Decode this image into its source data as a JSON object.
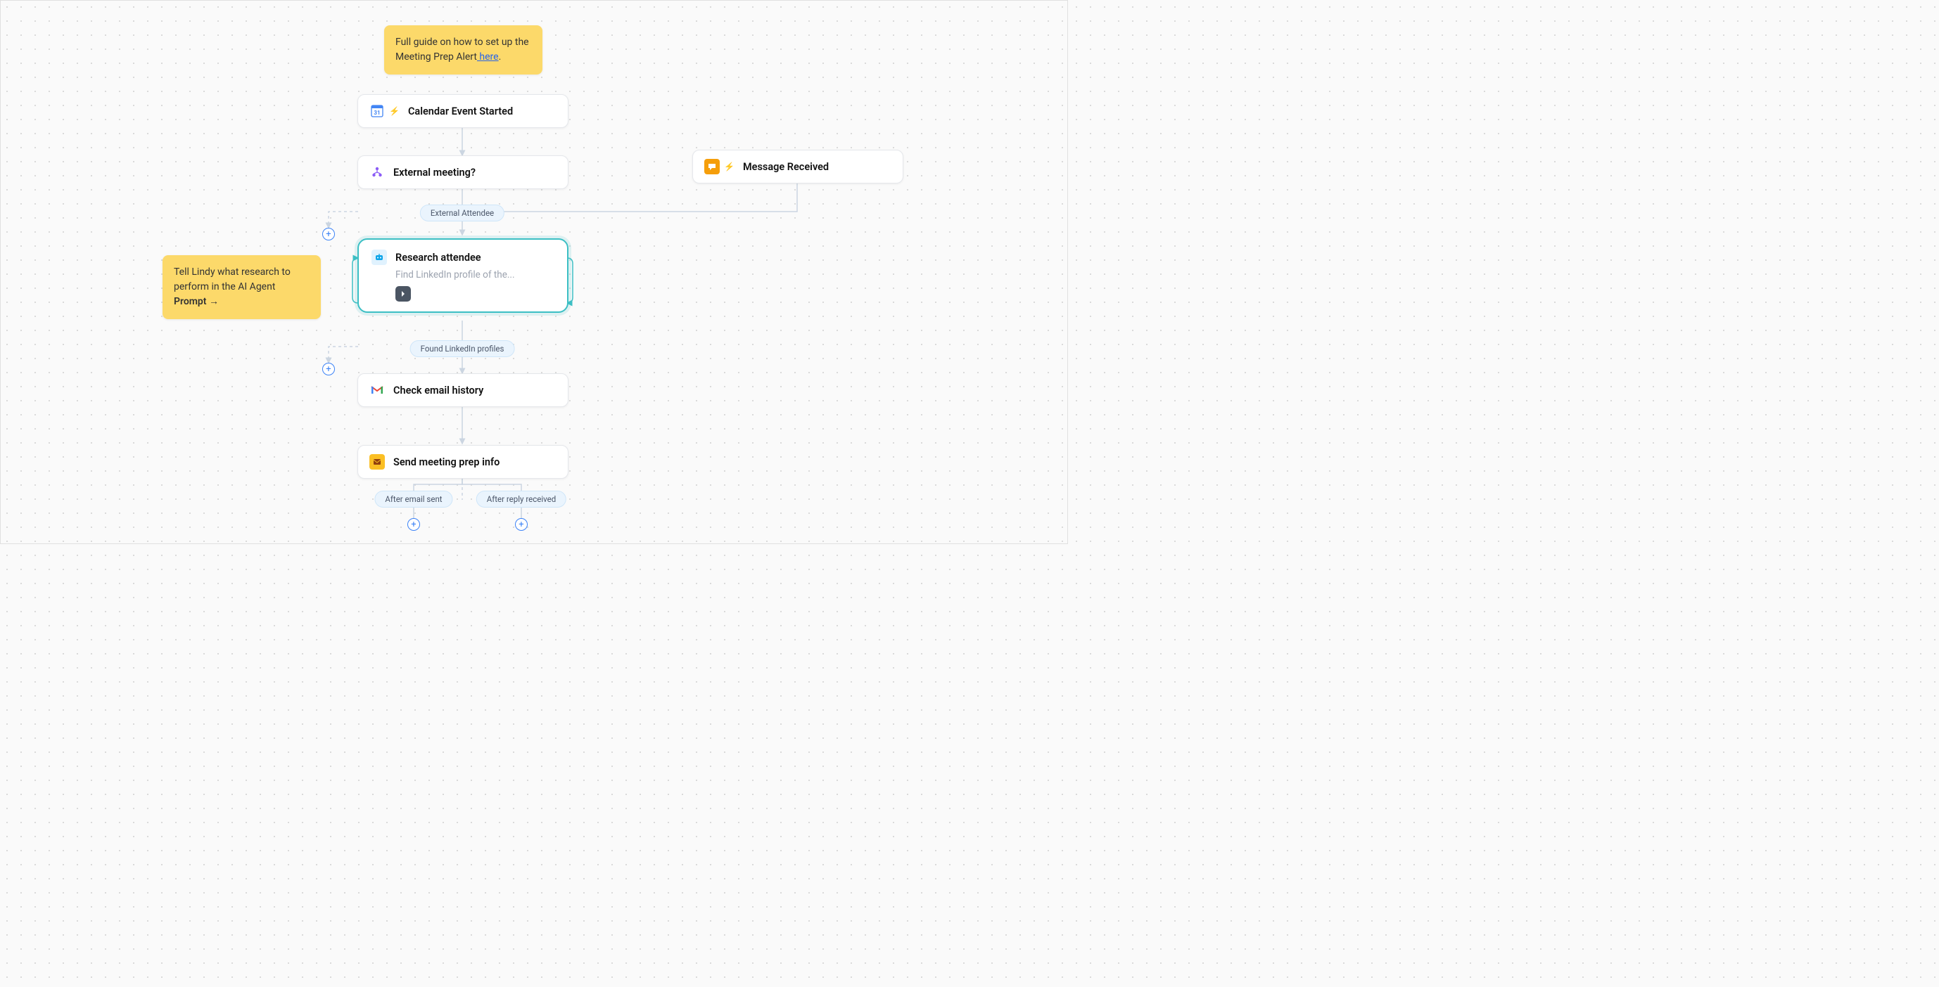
{
  "notes": {
    "guide": {
      "text_before": "Full guide on how to set up the Meeting Prep Alert",
      "link_text": " here",
      "text_after": "."
    },
    "prompt_hint": {
      "line1": "Tell Lindy what research to perform in the AI Agent",
      "bold": "Prompt →"
    }
  },
  "nodes": {
    "calendar": "Calendar Event Started",
    "external_meeting": "External meeting?",
    "message_received": "Message Received",
    "research": {
      "title": "Research attendee",
      "subtitle": "Find LinkedIn profile of the..."
    },
    "check_email": "Check email history",
    "send_prep": "Send meeting prep info"
  },
  "pills": {
    "external_attendee": "External Attendee",
    "found_linkedin": "Found LinkedIn profiles",
    "after_email_sent": "After email sent",
    "after_reply_received": "After reply received"
  }
}
